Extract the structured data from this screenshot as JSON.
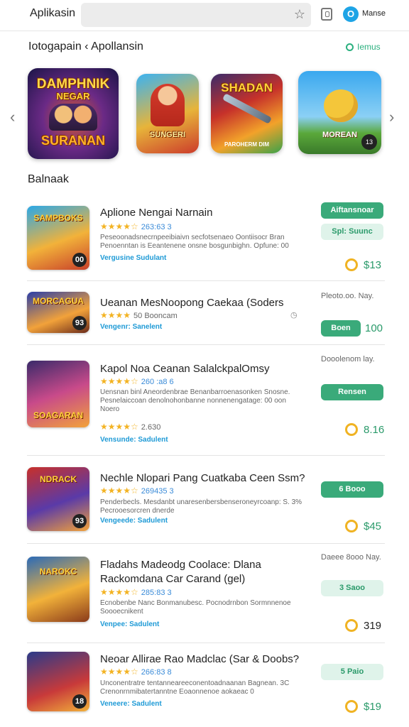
{
  "header": {
    "app_title": "Aplikasin",
    "search_placeholder": "",
    "user_initial": "O",
    "user_name": "Manse"
  },
  "breadcrumb": {
    "path": "Iotogapain ‹ Apollansin",
    "action_label": "Iemus"
  },
  "carousel": {
    "items": [
      {
        "line1": "DAMPHNIK",
        "line2": "NEGAR",
        "line3": "SURANAN"
      },
      {
        "line1": "SUNGERI"
      },
      {
        "line1": "SHADAN",
        "line2": "PAROHERM DIM"
      },
      {
        "line1": "MOREAN",
        "badge": "13"
      }
    ]
  },
  "section_title": "Balnaak",
  "apps": [
    {
      "thumb_text": "SAMPBOKS",
      "thumb_badge": "00",
      "title": "Aplione Nengai Narnain",
      "stars": "★★★★☆",
      "rating_text": "263:63 3",
      "desc": "Peseoonadsnecrnpeeibiaivn secfotsenaeo Oontiisocr Bran Penoenntan is Eeantenene onsne bosgunbighn. Opfune: 00",
      "tag": "Vergusine Sudulant",
      "button1": "Aiftansnoar",
      "button2": "Spl: Suunc",
      "price": "$13"
    },
    {
      "thumb_text": "MORCAGUA",
      "thumb_badge": "93",
      "title": "Ueanan MesNoopong Caekaa (Soders",
      "stars": "★★★★",
      "rating_text": "50 Booncam",
      "tag": "Vengenr: Sanelent",
      "meta": "Pleoto.oo. Nay.",
      "button1": "Boen",
      "price": "100"
    },
    {
      "thumb_text": "SOAGARAN",
      "thumb_badge": "",
      "title": "Kapol Noa Ceanan SalalckpalOmsy",
      "stars": "★★★★☆",
      "rating_text": "260 :a8 6",
      "desc": "Uensnan binl Aneordenbrae Benanbarroenasonken Snosne. Pesnelaiccoan denolnohonbanne nonnenengatage: 00 oon Noero",
      "sub_stars": "★★★★☆",
      "sub_rating": "2.630",
      "tag": "Vensunde: Sadulent",
      "meta": "Dooolenom lay.",
      "button1": "Rensen",
      "price": "8.16"
    },
    {
      "thumb_text": "NDRACK",
      "thumb_badge": "93",
      "title": "Nechle Nlopari Pang Cuatkaba Ceen Ssm?",
      "stars": "★★★★☆",
      "rating_text": "269435 3",
      "desc": "Penderbecls. Mesdanbt unaresenbersbenseroneyrcoanp: S. 3% Pecrooesorcren dnerde",
      "tag": "Vengeede: Sadulent",
      "button1": "6 Booo",
      "price": "$45"
    },
    {
      "thumb_text": "NAROKC",
      "thumb_badge": "",
      "title": "Fladahs Madeodg Coolace: Dlana",
      "title2": "Rackomdana Car Carand (gel)",
      "stars": "★★★★☆",
      "rating_text": "285:83 3",
      "desc": "Ecnobenbe Nanc Bonmanubesc. Pocnodrnbon Sormnnenoe Soooecnikent",
      "tag": "Venpee: Sadulent",
      "meta": "Daeee 8ooo Nay.",
      "button1": "3 Saoo",
      "price": "319"
    },
    {
      "thumb_text": "",
      "thumb_badge": "18",
      "title": "Neoar Allirae Rao Madclac (Sar & Doobs?",
      "stars": "★★★★☆",
      "rating_text": "266:83 8",
      "desc": "Unconentratre tentanneareeconentoadnaanan Bagnean. 3C Crenonrnmibatertanntne Eoaonnenoe aokaeac 0",
      "tag": "Veneere: Sadulent",
      "button1": "5 Paio",
      "price": "$19"
    }
  ],
  "colors": {
    "accent_green": "#3aaa7a",
    "link_blue": "#1e9ad6",
    "star_gold": "#f3b323"
  }
}
